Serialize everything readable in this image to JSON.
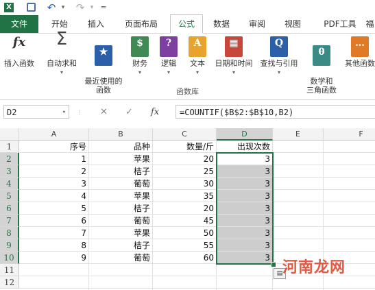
{
  "qat": {
    "undo_glyph": "↶",
    "redo_glyph": "↷",
    "more_glyph": "="
  },
  "tabs": [
    "文件",
    "开始",
    "插入",
    "页面布局",
    "公式",
    "数据",
    "审阅",
    "视图",
    "PDF工具",
    "福"
  ],
  "active_tab": "公式",
  "ribbon": {
    "buttons": [
      {
        "label": "插入函数",
        "glyph": "fx",
        "color": "#ffffff"
      },
      {
        "label": "自动求和",
        "glyph": "Σ",
        "color": "#ffffff"
      },
      {
        "label": "最近使用的\n函数",
        "glyph": "★",
        "color": "#2b5fa8"
      },
      {
        "label": "财务",
        "glyph": "$",
        "color": "#3f8a55"
      },
      {
        "label": "逻辑",
        "glyph": "?",
        "color": "#7d3fa0"
      },
      {
        "label": "文本",
        "glyph": "A",
        "color": "#e8a32c"
      },
      {
        "label": "日期和时间",
        "glyph": "▦",
        "color": "#c8463a"
      },
      {
        "label": "查找与引用",
        "glyph": "Q",
        "color": "#2b5fa8"
      },
      {
        "label": "数学和\n三角函数",
        "glyph": "θ",
        "color": "#3a8a86"
      },
      {
        "label": "其他函数",
        "glyph": "…",
        "color": "#e07a26"
      }
    ],
    "group_label": "函数库"
  },
  "formula_bar": {
    "name_box": "D2",
    "cancel": "✕",
    "enter": "✓",
    "fx": "fx",
    "formula": "=COUNTIF($B$2:$B$10,B2)"
  },
  "columns": [
    "A",
    "B",
    "C",
    "D",
    "E",
    "F"
  ],
  "rows": [
    "1",
    "2",
    "3",
    "4",
    "5",
    "6",
    "7",
    "8",
    "9",
    "10",
    "11",
    "12"
  ],
  "headers": {
    "A": "序号",
    "B": "品种",
    "C": "数量/斤",
    "D": "出现次数"
  },
  "data": [
    {
      "a": "1",
      "b": "苹果",
      "c": "20",
      "d": "3"
    },
    {
      "a": "2",
      "b": "桔子",
      "c": "25",
      "d": "3"
    },
    {
      "a": "3",
      "b": "葡萄",
      "c": "30",
      "d": "3"
    },
    {
      "a": "4",
      "b": "苹果",
      "c": "35",
      "d": "3"
    },
    {
      "a": "5",
      "b": "桔子",
      "c": "20",
      "d": "3"
    },
    {
      "a": "6",
      "b": "葡萄",
      "c": "45",
      "d": "3"
    },
    {
      "a": "7",
      "b": "苹果",
      "c": "50",
      "d": "3"
    },
    {
      "a": "8",
      "b": "桔子",
      "c": "55",
      "d": "3"
    },
    {
      "a": "9",
      "b": "葡萄",
      "c": "60",
      "d": "3"
    }
  ],
  "watermark": "河南龙网",
  "colors": {
    "accent": "#217346"
  }
}
